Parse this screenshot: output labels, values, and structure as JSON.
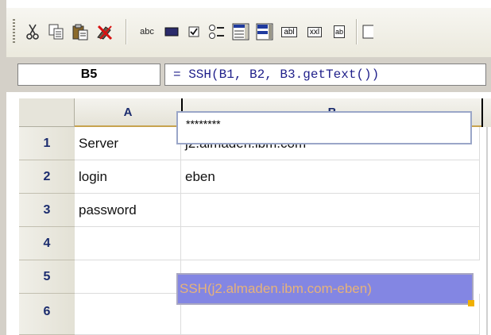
{
  "toolbar": {
    "buttons": [
      {
        "name": "cut-icon"
      },
      {
        "name": "copy-icon"
      },
      {
        "name": "paste-icon"
      },
      {
        "name": "clear-format-icon"
      },
      {
        "name": "label-tool-icon",
        "text": "abc"
      },
      {
        "name": "button-tool-icon"
      },
      {
        "name": "checkbox-tool-icon"
      },
      {
        "name": "radio-list-tool-icon"
      },
      {
        "name": "list-box-tool-icon"
      },
      {
        "name": "combo-box-tool-icon"
      },
      {
        "name": "text-field-tool-icon",
        "text": "abl"
      },
      {
        "name": "password-field-tool-icon",
        "text": "xxl"
      },
      {
        "name": "text-area-tool-icon",
        "text": "ab"
      },
      {
        "name": "more-tools-icon"
      }
    ]
  },
  "formula_bar": {
    "cell_ref": "B5",
    "formula": "= SSH(B1, B2, B3.getText())"
  },
  "sheet": {
    "columns": [
      "A",
      "B"
    ],
    "rows": [
      {
        "num": "1",
        "a": "Server",
        "b": "j2.almaden.ibm.com"
      },
      {
        "num": "2",
        "a": "login",
        "b": "eben"
      },
      {
        "num": "3",
        "a": "password",
        "b": "********"
      },
      {
        "num": "4",
        "a": "",
        "b": ""
      },
      {
        "num": "5",
        "a": "",
        "b": "SSH(j2.almaden.ibm.com-eben)"
      },
      {
        "num": "6",
        "a": "",
        "b": ""
      }
    ],
    "selected_cell": "B5"
  },
  "colors": {
    "selection": "#8386e3",
    "selection_text": "#e6b27a",
    "header_text": "#1b2c6e",
    "column_underline": "#c7a34e"
  }
}
